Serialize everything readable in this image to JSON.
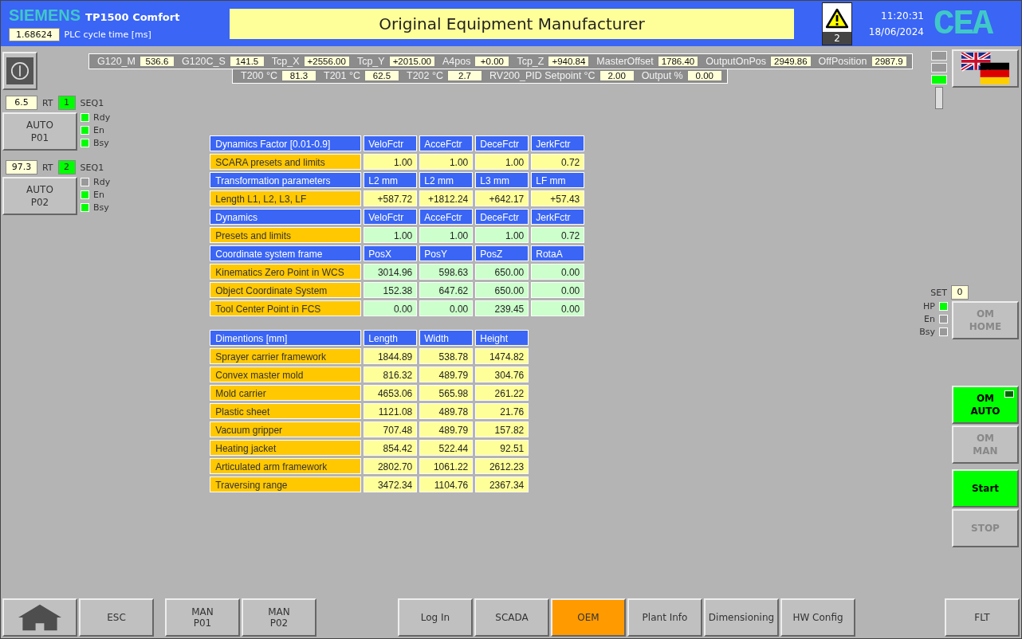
{
  "header": {
    "brand": "SIEMENS",
    "model": "TP1500 Comfort",
    "cycle_value": "1.68624",
    "cycle_label": "PLC cycle time [ms]",
    "title": "Original Equipment Manufacturer",
    "alarm_count": "2",
    "time": "11:20:31",
    "date": "18/06/2024",
    "logo": "CEA"
  },
  "telemetry": [
    [
      {
        "label": "G120_M",
        "value": "536.6"
      },
      {
        "label": "G120C_S",
        "value": "141.5"
      },
      {
        "label": "Tcp_X",
        "value": "+2556.00"
      },
      {
        "label": "Tcp_Y",
        "value": "+2015.00"
      },
      {
        "label": "A4pos",
        "value": "+0.00"
      },
      {
        "label": "Tcp_Z",
        "value": "+940.84"
      },
      {
        "label": "MasterOffset",
        "value": "1786.40"
      },
      {
        "label": "OutputOnPos",
        "value": "2949.86"
      },
      {
        "label": "OffPosition",
        "value": "2987.9"
      }
    ],
    [
      {
        "label": "T200 °C",
        "value": "81.3"
      },
      {
        "label": "T201 °C",
        "value": "62.5"
      },
      {
        "label": "T202 °C",
        "value": "2.7"
      },
      {
        "label": "RV200_PID Setpoint °C",
        "value": "2.00"
      },
      {
        "label": "Output %",
        "value": "0.00"
      }
    ]
  ],
  "stations": [
    {
      "value": "6.5",
      "unit": "RT",
      "seq_number": "1",
      "seq_label": "SEQ1",
      "button": "AUTO\nP01",
      "indicators": [
        {
          "label": "Rdy",
          "on": true
        },
        {
          "label": "En",
          "on": true
        },
        {
          "label": "Bsy",
          "on": true
        }
      ]
    },
    {
      "value": "97.3",
      "unit": "RT",
      "seq_number": "2",
      "seq_label": "SEQ1",
      "button": "AUTO\nP02",
      "indicators": [
        {
          "label": "Rdy",
          "on": false
        },
        {
          "label": "En",
          "on": true
        },
        {
          "label": "Bsy",
          "on": true
        }
      ]
    }
  ],
  "tables": [
    {
      "rows": [
        {
          "kind": "header",
          "cells": [
            "Dynamics Factor [0.01-0.9]",
            "VeloFctr",
            "AcceFctr",
            "DeceFctr",
            "JerkFctr"
          ]
        },
        {
          "kind": "preset",
          "cells": [
            "SCARA presets and limits",
            "1.00",
            "1.00",
            "1.00",
            "0.72"
          ]
        },
        {
          "kind": "header",
          "cells": [
            "Transformation parameters",
            "L2 mm",
            "L2 mm",
            "L3 mm",
            "LF mm"
          ]
        },
        {
          "kind": "preset",
          "cells": [
            "Length L1, L2, L3, LF",
            "+587.72",
            "+1812.24",
            "+642.17",
            "+57.43"
          ]
        },
        {
          "kind": "header",
          "cells": [
            "Dynamics",
            "VeloFctr",
            "AcceFctr",
            "DeceFctr",
            "JerkFctr"
          ]
        },
        {
          "kind": "measured",
          "cells": [
            "Presets and limits",
            "1.00",
            "1.00",
            "1.00",
            "0.72"
          ]
        },
        {
          "kind": "header",
          "cells": [
            "Coordinate system frame",
            "PosX",
            "PosY",
            "PosZ",
            "RotaA"
          ]
        },
        {
          "kind": "measured",
          "cells": [
            "Kinematics Zero Point in WCS",
            "3014.96",
            "598.63",
            "650.00",
            "0.00"
          ]
        },
        {
          "kind": "measured",
          "cells": [
            "Object Coordinate System",
            "152.38",
            "647.62",
            "650.00",
            "0.00"
          ]
        },
        {
          "kind": "measured",
          "cells": [
            "Tool Center Point in FCS",
            "0.00",
            "0.00",
            "239.45",
            "0.00"
          ]
        }
      ]
    },
    {
      "rows": [
        {
          "kind": "header",
          "cells": [
            "Dimentions [mm]",
            "Length",
            "Width",
            "Height"
          ]
        },
        {
          "kind": "preset",
          "cells": [
            "Sprayer carrier framework",
            "1844.89",
            "538.78",
            "1474.82"
          ]
        },
        {
          "kind": "preset",
          "cells": [
            "Convex master mold",
            "816.32",
            "489.79",
            "304.76"
          ]
        },
        {
          "kind": "preset",
          "cells": [
            "Mold carrier",
            "4653.06",
            "565.98",
            "261.22"
          ]
        },
        {
          "kind": "preset",
          "cells": [
            "Plastic sheet",
            "1121.08",
            "489.78",
            "21.76"
          ]
        },
        {
          "kind": "preset",
          "cells": [
            "Vacuum gripper",
            "707.48",
            "489.79",
            "157.82"
          ]
        },
        {
          "kind": "preset",
          "cells": [
            "Heating jacket",
            "854.42",
            "522.44",
            "92.51"
          ]
        },
        {
          "kind": "preset",
          "cells": [
            "Articulated arm framework",
            "2802.70",
            "1061.22",
            "2612.23"
          ]
        },
        {
          "kind": "preset",
          "cells": [
            "Traversing range",
            "3472.34",
            "1104.76",
            "2367.34"
          ]
        }
      ]
    }
  ],
  "right_panel": {
    "indicators": [
      {
        "on": false
      },
      {
        "on": false
      },
      {
        "on": true
      }
    ],
    "set_label": "SET",
    "set_value": "0",
    "status": [
      {
        "label": "HP",
        "on": true
      },
      {
        "label": "En",
        "on": false
      },
      {
        "label": "Bsy",
        "on": false
      }
    ],
    "home_button": {
      "label": "OM\nHOME",
      "active": false
    },
    "mode_buttons": [
      {
        "label": "OM\nAUTO",
        "active": true
      },
      {
        "label": "OM\nMAN",
        "active": false
      }
    ],
    "action_buttons": [
      {
        "label": "Start",
        "active": true
      },
      {
        "label": "STOP",
        "active": false
      }
    ]
  },
  "footer_groups": [
    [
      {
        "kind": "home",
        "selected": false
      },
      {
        "kind": "text",
        "label": "ESC",
        "selected": false
      },
      {
        "kind": "text",
        "label": "MAN\nP01",
        "selected": false
      },
      {
        "kind": "text",
        "label": "MAN\nP02",
        "selected": false
      }
    ],
    [
      {
        "kind": "text",
        "label": "Log In",
        "selected": false
      },
      {
        "kind": "text",
        "label": "SCADA",
        "selected": false
      },
      {
        "kind": "text",
        "label": "OEM",
        "selected": true
      },
      {
        "kind": "text",
        "label": "Plant Info",
        "selected": false
      },
      {
        "kind": "text",
        "label": "Dimensioning",
        "selected": false
      },
      {
        "kind": "text",
        "label": "HW Config",
        "selected": false
      }
    ],
    [
      {
        "kind": "text",
        "label": "FLT",
        "selected": false
      }
    ]
  ]
}
